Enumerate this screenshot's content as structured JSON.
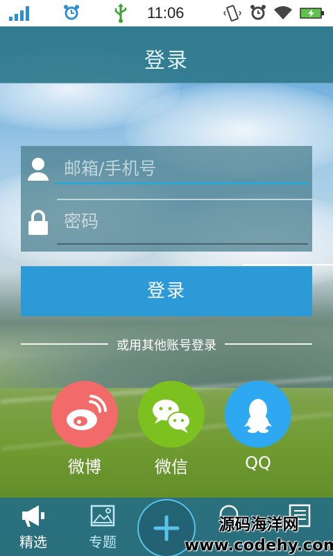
{
  "status_bar": {
    "time": "11:06",
    "icons": [
      "signal-icon",
      "alarm-icon",
      "usb-icon",
      "vibrate-icon",
      "alarm-clock-icon",
      "wifi-icon",
      "battery-charging-icon"
    ],
    "accent_color": "#2b8fd6"
  },
  "header": {
    "title": "登录"
  },
  "login_form": {
    "account_placeholder": "邮箱/手机号",
    "password_placeholder": "密码",
    "account_icon": "user-icon",
    "password_icon": "lock-icon",
    "submit_label": "登录",
    "submit_color": "#2b9ad6"
  },
  "third_party": {
    "separator_text": "或用其他账号登录",
    "providers": [
      {
        "label": "微博",
        "icon": "weibo-icon",
        "color": "#f26a6a"
      },
      {
        "label": "微信",
        "icon": "wechat-icon",
        "color": "#7cc11f"
      },
      {
        "label": "QQ",
        "icon": "qq-icon",
        "color": "#2ea8f0"
      }
    ]
  },
  "bottom_nav": {
    "items": [
      {
        "label": "精选",
        "icon": "megaphone-icon"
      },
      {
        "label": "专题",
        "icon": "image-icon"
      },
      {
        "label": "",
        "icon": "plus-icon"
      },
      {
        "label": "",
        "icon": "search-icon"
      },
      {
        "label": "",
        "icon": "notebook-icon"
      }
    ]
  },
  "watermark": {
    "line1": "源码海洋网",
    "line2": "www.codehy.com"
  }
}
